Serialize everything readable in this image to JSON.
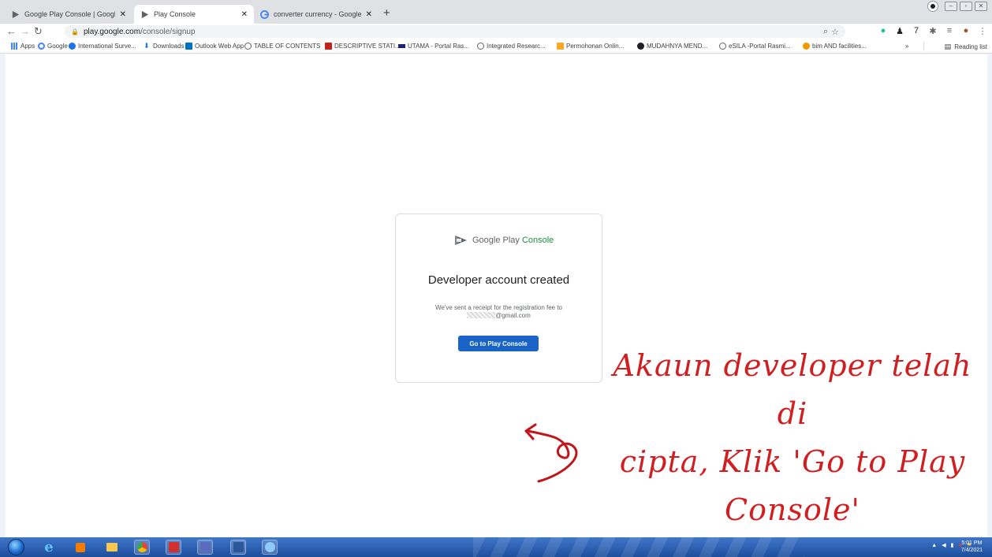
{
  "browser": {
    "tabs": [
      {
        "title": "Google Play Console | Google Pl..",
        "active": false
      },
      {
        "title": "Play Console",
        "active": true
      },
      {
        "title": "converter currency - Google Sea",
        "active": false
      }
    ],
    "new_tab_label": "+",
    "close_glyph": "✕",
    "url_host": "play.google.com",
    "url_path": "/console/signup",
    "bookmarks": [
      {
        "label": "Apps",
        "icon": "apps-grid-icon",
        "color": "#4285f4"
      },
      {
        "label": "Google",
        "icon": "google-g-icon",
        "color": "#4285f4"
      },
      {
        "label": "International Surve...",
        "icon": "globe-icon",
        "color": "#1a73e8"
      },
      {
        "label": "Downloads",
        "icon": "download-icon",
        "color": "#1a73e8"
      },
      {
        "label": "Outlook Web App",
        "icon": "outlook-icon",
        "color": "#0072c6"
      },
      {
        "label": "TABLE OF CONTENTS",
        "icon": "globe-icon",
        "color": "#5f6368"
      },
      {
        "label": "DESCRIPTIVE STATI...",
        "icon": "page-icon",
        "color": "#c5221f"
      },
      {
        "label": "UTAMA - Portal Ras...",
        "icon": "flag-icon",
        "color": "#1a237e"
      },
      {
        "label": "Integrated Researc...",
        "icon": "globe-icon",
        "color": "#5f6368"
      },
      {
        "label": "Permohonan Onlin...",
        "icon": "crest-icon",
        "color": "#f9a825"
      },
      {
        "label": "MUDAHNYA MEND...",
        "icon": "circle-icon",
        "color": "#202124"
      },
      {
        "label": "eSILA -Portal Rasmi...",
        "icon": "globe-icon",
        "color": "#5f6368"
      },
      {
        "label": "bim AND facilities...",
        "icon": "bim-icon",
        "color": "#f29900"
      }
    ],
    "reading_list_label": "Reading list",
    "overflow_label": "»"
  },
  "card": {
    "logo_text_1": "Google Play",
    "logo_text_2": "Console",
    "headline": "Developer account created",
    "receipt_line_1": "We've sent a receipt for the registration fee to",
    "receipt_email_suffix": "@gmail.com",
    "cta_label": "Go to Play Console"
  },
  "annotation": {
    "line_1": "Akaun developer telah di",
    "line_2": "cipta, Klik 'Go to Play",
    "line_3": "Console'"
  },
  "taskbar": {
    "time": "5:01 PM",
    "date": "7/4/2021",
    "apps": [
      {
        "name": "internet-explorer-icon",
        "color": "#1e88e5"
      },
      {
        "name": "media-player-icon",
        "color": "#f57c00"
      },
      {
        "name": "file-explorer-icon",
        "color": "#f9c74f"
      },
      {
        "name": "chrome-icon",
        "color": "#34a853"
      },
      {
        "name": "acrobat-icon",
        "color": "#d32f2f"
      },
      {
        "name": "teams-icon",
        "color": "#5c6bc0"
      },
      {
        "name": "word-icon",
        "color": "#2b579a"
      },
      {
        "name": "paint-icon",
        "color": "#90caf9"
      }
    ]
  }
}
